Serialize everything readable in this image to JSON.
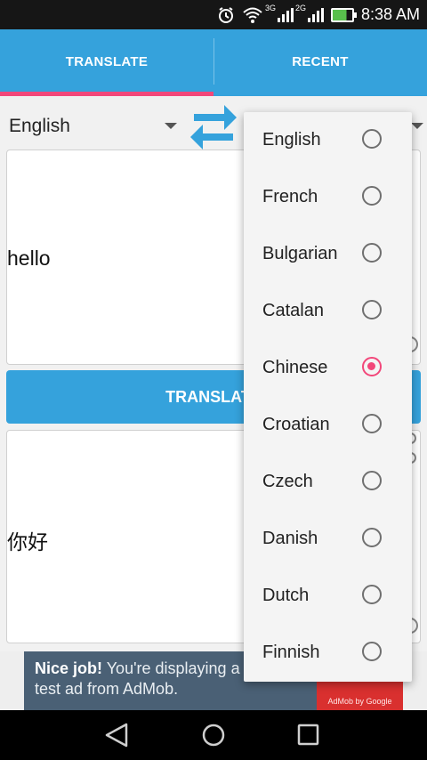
{
  "status": {
    "time": "8:38 AM",
    "sim1": "3G",
    "sim2": "2G"
  },
  "tabs": [
    {
      "label": "TRANSLATE",
      "active": true
    },
    {
      "label": "RECENT",
      "active": false
    }
  ],
  "source_language": "English",
  "input_text": "hello",
  "translate_button": "TRANSLATE",
  "output_text": "你好",
  "ad": {
    "headline": "Nice job!",
    "body": "You're displaying a test ad from AdMob.",
    "logo_text": "AdMob by Google"
  },
  "language_options": [
    {
      "label": "English",
      "selected": false
    },
    {
      "label": "French",
      "selected": false
    },
    {
      "label": "Bulgarian",
      "selected": false
    },
    {
      "label": "Catalan",
      "selected": false
    },
    {
      "label": "Chinese",
      "selected": true
    },
    {
      "label": "Croatian",
      "selected": false
    },
    {
      "label": "Czech",
      "selected": false
    },
    {
      "label": "Danish",
      "selected": false
    },
    {
      "label": "Dutch",
      "selected": false
    },
    {
      "label": "Finnish",
      "selected": false
    }
  ],
  "colors": {
    "accent": "#35a2dc",
    "indicator": "#f2477a",
    "ad_bg": "#4a6075",
    "admob_red": "#d9302f"
  },
  "icons": [
    "alarm-icon",
    "wifi-icon",
    "signal-icon",
    "battery-icon",
    "swap-languages-icon",
    "back-icon",
    "home-icon",
    "recents-icon"
  ]
}
